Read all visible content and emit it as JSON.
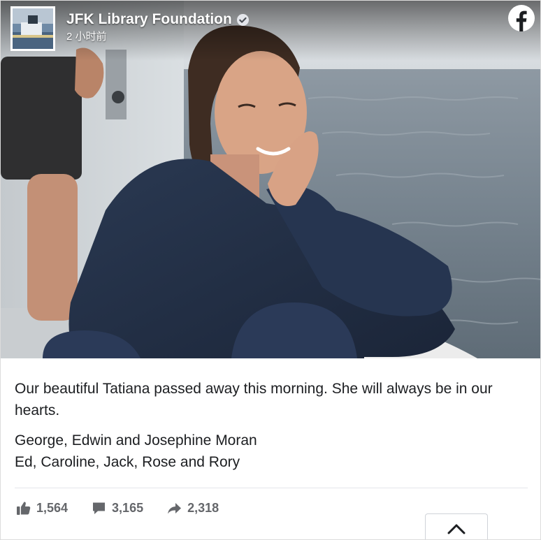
{
  "post": {
    "page_name": "JFK Library Foundation",
    "timestamp": "2 小时前",
    "body_main": "Our beautiful Tatiana passed away this morning. She will always be in our hearts.",
    "signature_line_1": "George, Edwin and Josephine Moran",
    "signature_line_2": "Ed, Caroline, Jack, Rose and Rory"
  },
  "stats": {
    "likes": "1,564",
    "comments": "3,165",
    "shares": "2,318"
  },
  "icons": {
    "verified": "verified-badge-icon",
    "facebook": "facebook-logo-icon",
    "like": "thumbs-up-icon",
    "comment": "comment-icon",
    "share": "share-arrow-icon",
    "collapse": "chevron-up-icon"
  },
  "colors": {
    "facebook_blue": "#1877f2",
    "stat_gray": "#65676b",
    "text": "#1c1e21"
  }
}
